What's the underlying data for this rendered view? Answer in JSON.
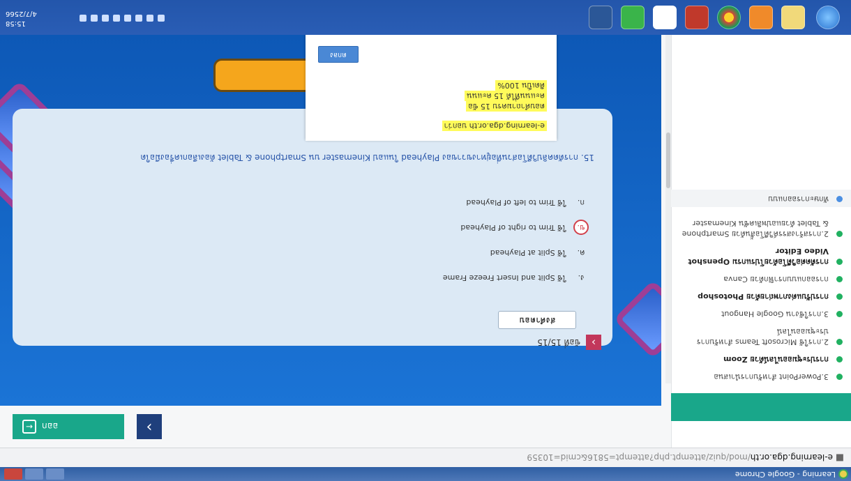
{
  "browser": {
    "title": "Learning - Google Chrome",
    "url_host": "e-learning.dga.or.th",
    "url_path": "/mod/quiz/attempt.php?attempt=5816&cmid=10359"
  },
  "sidebar": {
    "items": [
      {
        "label": "ทักษะการออกแบบ",
        "bold": false,
        "current": true
      },
      {
        "label": "2.การสร้างสรรค์วิดีโอสั้นด้วย Smartphone & Tablet ด้วยแอปพลิเคชัน Kinemaster",
        "bold": false
      },
      {
        "label": "การตัดต่อวิดีโอด้วยโปรแกรม Openshot Video Editor",
        "bold": true
      },
      {
        "label": "การออกแบบกราฟิกด้วย Canva",
        "bold": false
      },
      {
        "label": "การปรับแต่งภาพถ่ายด้วย Photoshop",
        "bold": true
      },
      {
        "label": "3.การใช้งาน Google Hangout",
        "bold": false
      },
      {
        "label": "2.การใช้ Microsoft Teams สำหรับการประชุมออนไลน์",
        "bold": false
      },
      {
        "label": "การประชุมออนไลน์ด้วย Zoom",
        "bold": true
      },
      {
        "label": "3.PowerPoint สำหรับการนำเสนอ",
        "bold": false
      }
    ]
  },
  "nav": {
    "back_label": "ออก",
    "back_icon": "exit-icon",
    "prev_icon": "chevron-right-icon"
  },
  "question": {
    "progress": "ข้อที่ 15/15",
    "text": "15. การตัดคลิปวิดีโอส่วนที่อยู่ทางขวาของ Playhead ในแอป Kinemaster บน Smartphone & Tablet ต้องเลือกเครื่องมือใด",
    "options": [
      {
        "letter": "ก.",
        "text": "ใช้ Trim to left of Playhead",
        "selected": false
      },
      {
        "letter": "ข.",
        "text": "ใช้ Trim to right of Playhead",
        "selected": true
      },
      {
        "letter": "ค.",
        "text": "ใช้ Split at Playhead",
        "selected": false
      },
      {
        "letter": "ง.",
        "text": "ใช้ Split and Insert Freeze Frame",
        "selected": false
      }
    ],
    "submit_label": "ส่งคำตอบ"
  },
  "popup": {
    "url": "e-learning.dga.or.th บอกว่า",
    "cond1": "ตอบคำถามครบ 15 ข้อ",
    "cond2": "คะแนนที่ได้ 15 คะแนน",
    "cond3": "คิดเป็น 100%",
    "ok_label": "ตกลง"
  },
  "taskbar": {
    "time": "15:58",
    "date": "4/7/2566"
  }
}
